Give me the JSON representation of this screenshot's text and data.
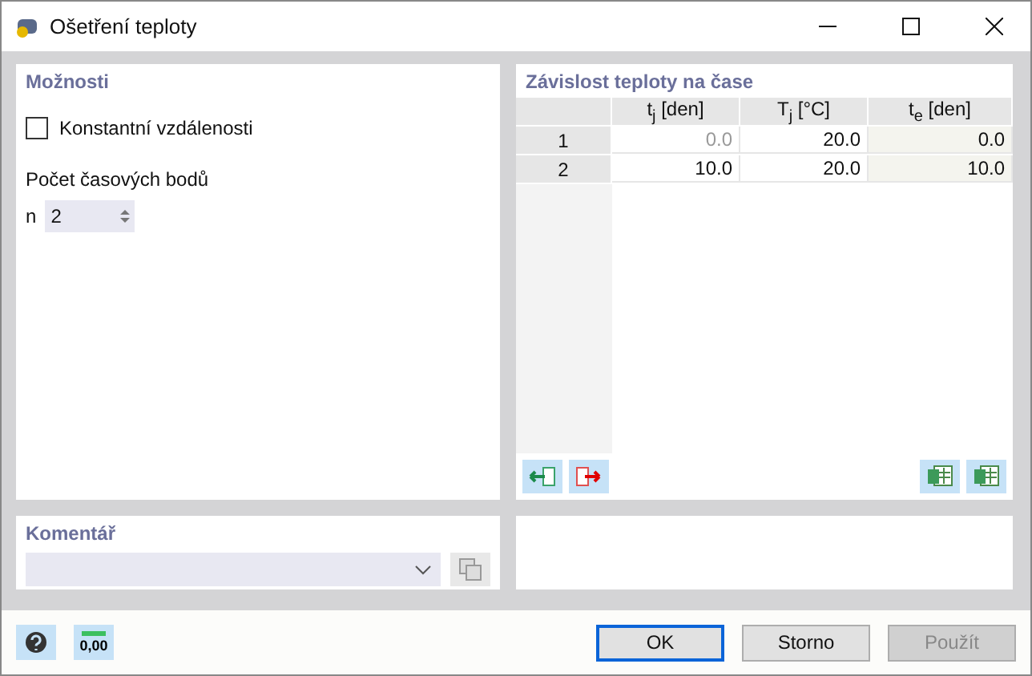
{
  "window": {
    "title": "Ošetření teploty"
  },
  "options": {
    "title": "Možnosti",
    "constant_distance": {
      "label": "Konstantní vzdálenosti",
      "checked": false
    },
    "points": {
      "label": "Počet časových bodů",
      "symbol": "n",
      "value": "2"
    }
  },
  "table": {
    "title": "Závislost teploty na čase",
    "columns": [
      "t$_{j}$ [den]",
      "T$_{j}$ [°C]",
      "t$_{e}$ [den]"
    ],
    "rows": [
      {
        "number": "1",
        "cells": [
          {
            "value": "0.0",
            "disabled": true
          },
          {
            "value": "20.0",
            "disabled": false
          },
          {
            "value": "0.0",
            "disabled": false
          }
        ]
      },
      {
        "number": "2",
        "cells": [
          {
            "value": "10.0",
            "disabled": false
          },
          {
            "value": "20.0",
            "disabled": false
          },
          {
            "value": "10.0",
            "disabled": false
          }
        ]
      }
    ]
  },
  "comment": {
    "title": "Komentář"
  },
  "footer": {
    "units_label": "0,00",
    "buttons": [
      {
        "label": "OK",
        "kind": "default",
        "disabled": false
      },
      {
        "label": "Storno",
        "kind": "normal",
        "disabled": false
      },
      {
        "label": "Použít",
        "kind": "normal",
        "disabled": true
      }
    ]
  }
}
